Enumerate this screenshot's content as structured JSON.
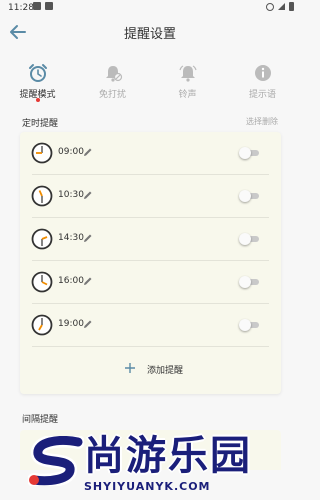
{
  "status_bar": {
    "time": "11:28"
  },
  "header": {
    "title": "提醒设置"
  },
  "tabs": [
    {
      "label": "提醒模式",
      "icon": "alarm-clock-icon",
      "active": true
    },
    {
      "label": "免打扰",
      "icon": "bell-off-icon",
      "active": false
    },
    {
      "label": "铃声",
      "icon": "bell-icon",
      "active": false
    },
    {
      "label": "提示语",
      "icon": "info-icon",
      "active": false
    }
  ],
  "timed_reminders": {
    "title": "定时提醒",
    "action": "选择删除",
    "items": [
      {
        "time": "09:00",
        "enabled": false
      },
      {
        "time": "10:30",
        "enabled": false
      },
      {
        "time": "14:30",
        "enabled": false
      },
      {
        "time": "16:00",
        "enabled": false
      },
      {
        "time": "19:00",
        "enabled": false
      }
    ],
    "add_label": "添加提醒"
  },
  "interval_reminders": {
    "title": "间隔提醒"
  },
  "watermark": {
    "brand": "尚游乐园",
    "url": "SHYIYUANYK.COM"
  },
  "colors": {
    "accent": "#5a8ba6",
    "card": "#f8f8ec",
    "clock_hand": "#f08c00",
    "active_dot": "#e53935",
    "watermark": "#1b1f7a"
  }
}
